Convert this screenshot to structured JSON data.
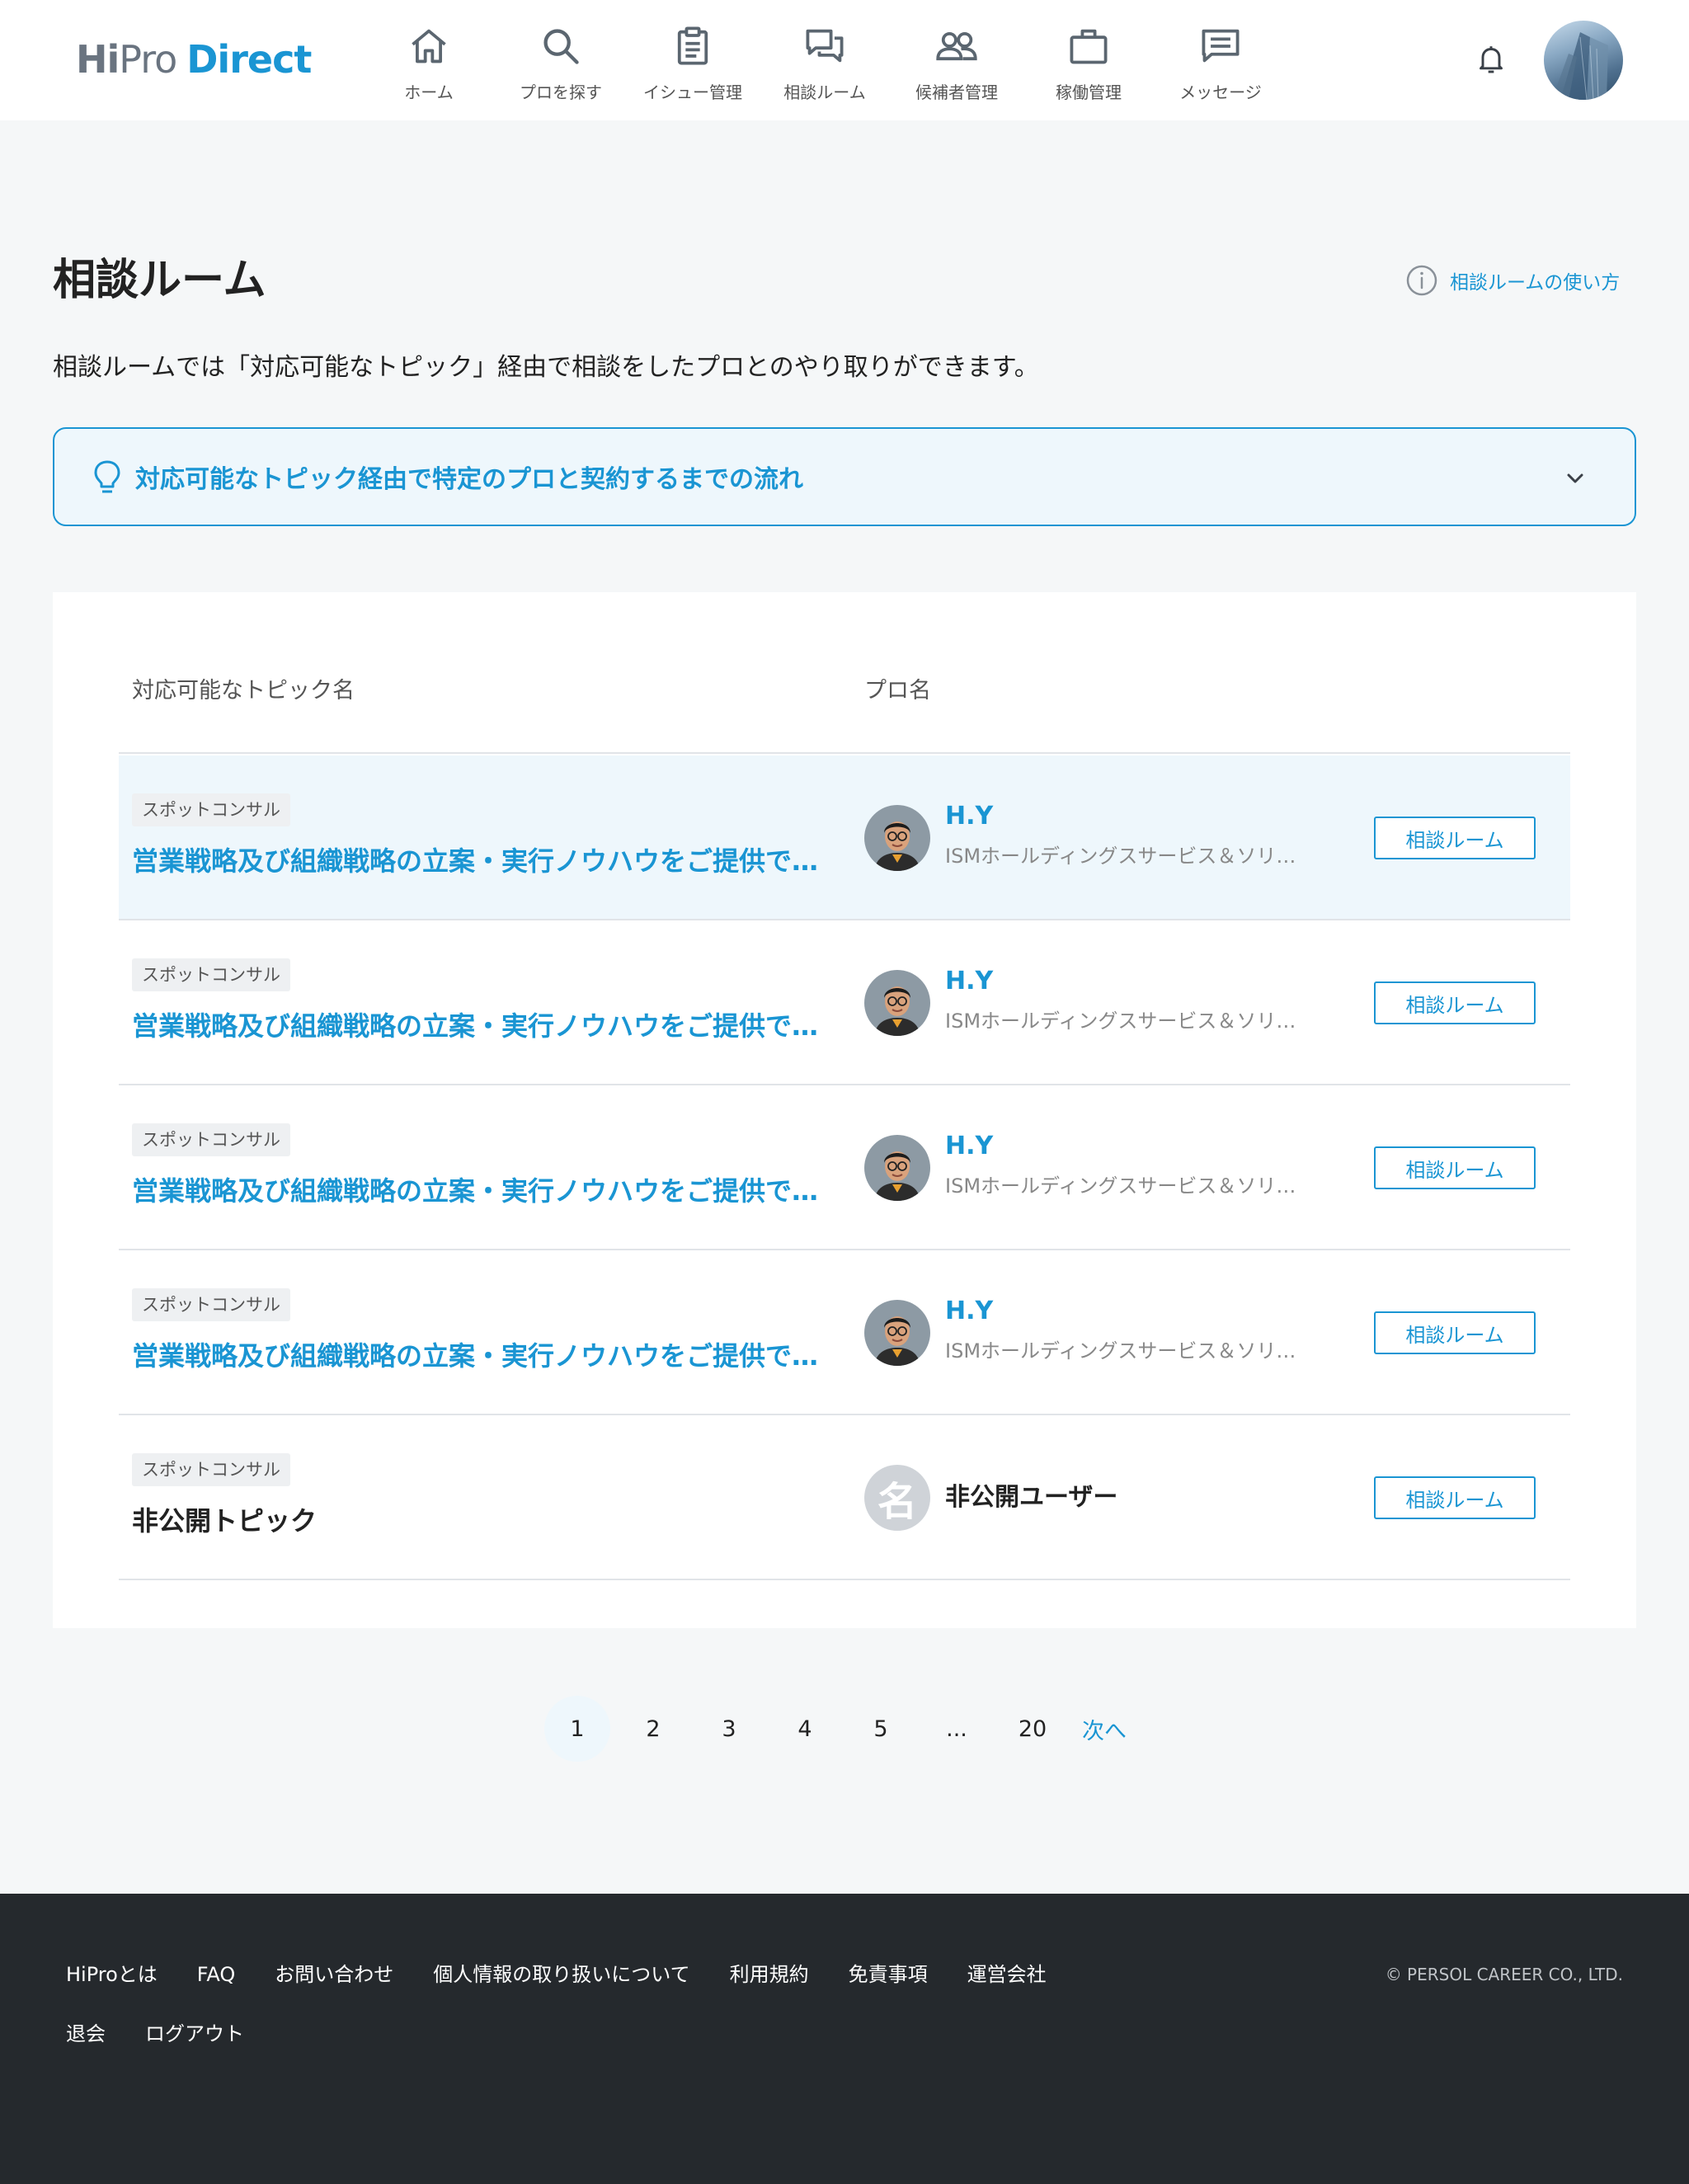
{
  "header": {
    "logo": {
      "hi": "Hi",
      "pro": "Pro",
      "direct": "Direct"
    },
    "nav": [
      {
        "label": "ホーム",
        "icon": "home-icon"
      },
      {
        "label": "プロを探す",
        "icon": "search-icon"
      },
      {
        "label": "イシュー管理",
        "icon": "clipboard-icon"
      },
      {
        "label": "相談ルーム",
        "icon": "chat-icon"
      },
      {
        "label": "候補者管理",
        "icon": "people-icon"
      },
      {
        "label": "稼働管理",
        "icon": "briefcase-icon"
      },
      {
        "label": "メッセージ",
        "icon": "message-icon"
      }
    ],
    "notification_icon": "bell-icon",
    "avatar_icon": "user-avatar"
  },
  "page": {
    "title": "相談ルーム",
    "help_link": "相談ルームの使い方",
    "intro": "相談ルームでは「対応可能なトピック」経由で相談をしたプロとのやり取りができます。",
    "accordion_label": "対応可能なトピック経由で特定のプロと契約するまでの流れ"
  },
  "table": {
    "columns": {
      "topic": "対応可能なトピック名",
      "pro": "プロ名"
    },
    "rows": [
      {
        "tag": "スポットコンサル",
        "topic": "営業戦略及び組織戦略の立案・実行ノウハウをご提供できます",
        "pro_name": "H.Y",
        "company": "ISMホールディングスサービス＆ソリューション",
        "button": "相談ルーム"
      },
      {
        "tag": "スポットコンサル",
        "topic": "営業戦略及び組織戦略の立案・実行ノウハウをご提供できます",
        "pro_name": "H.Y",
        "company": "ISMホールディングスサービス＆ソリューション",
        "button": "相談ルーム"
      },
      {
        "tag": "スポットコンサル",
        "topic": "営業戦略及び組織戦略の立案・実行ノウハウをご提供できます",
        "pro_name": "H.Y",
        "company": "ISMホールディングスサービス＆ソリューション",
        "button": "相談ルーム"
      },
      {
        "tag": "スポットコンサル",
        "topic": "営業戦略及び組織戦略の立案・実行ノウハウをご提供できます",
        "pro_name": "H.Y",
        "company": "ISMホールディングスサービス＆ソリューション",
        "button": "相談ルーム"
      },
      {
        "tag": "スポットコンサル",
        "topic": "非公開トピック",
        "pro_name": "非公開ユーザー",
        "avatar_char": "名",
        "button": "相談ルーム"
      }
    ]
  },
  "pagination": {
    "pages": [
      "1",
      "2",
      "3",
      "4",
      "5",
      "...",
      "20"
    ],
    "current": "1",
    "next": "次へ"
  },
  "footer": {
    "links_row1": [
      "HiProとは",
      "FAQ",
      "お問い合わせ",
      "個人情報の取り扱いについて",
      "利用規約",
      "免責事項",
      "運営会社"
    ],
    "links_row2": [
      "退会",
      "ログアウト"
    ],
    "copyright": "© PERSOL CAREER CO., LTD."
  },
  "colors": {
    "accent": "#1a95d3",
    "highlight_row": "#eef7fc",
    "footer_bg": "#25292d"
  }
}
